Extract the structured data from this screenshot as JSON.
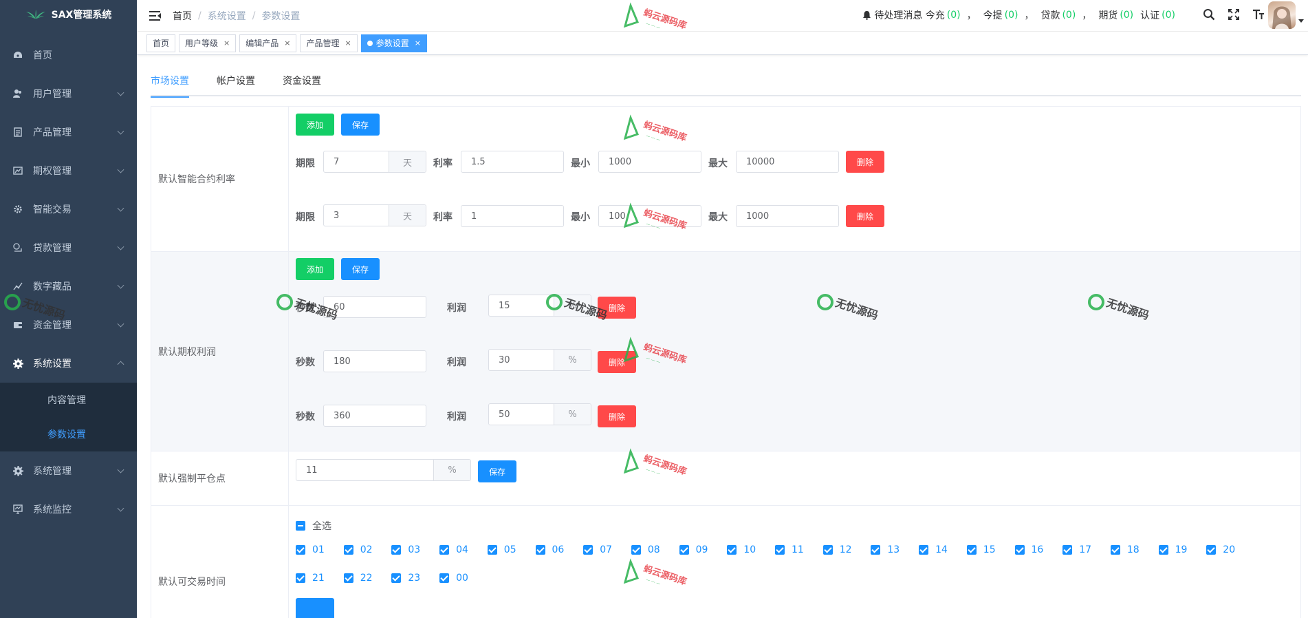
{
  "sidebar": {
    "logo_text": "SAX管理系统",
    "items": [
      {
        "label": "首页",
        "icon": "dashboard-icon"
      },
      {
        "label": "用户管理",
        "icon": "user-icon"
      },
      {
        "label": "产品管理",
        "icon": "document-icon"
      },
      {
        "label": "期权管理",
        "icon": "chart-icon"
      },
      {
        "label": "智能交易",
        "icon": "gear-icon"
      },
      {
        "label": "贷款管理",
        "icon": "money-icon"
      },
      {
        "label": "数字藏品",
        "icon": "trend-icon"
      },
      {
        "label": "资金管理",
        "icon": "wallet-icon"
      },
      {
        "label": "系统设置",
        "icon": "settings-icon"
      },
      {
        "label": "系统管理",
        "icon": "settings-icon"
      },
      {
        "label": "系统监控",
        "icon": "monitor-icon"
      }
    ],
    "sub_items": [
      {
        "label": "内容管理"
      },
      {
        "label": "参数设置"
      }
    ]
  },
  "header": {
    "breadcrumb": [
      "首页",
      "系统设置",
      "参数设置"
    ],
    "notify_label": "待处理消息 今充",
    "notify_items": [
      {
        "prefix": "",
        "count": "(0)",
        "sep": "，"
      },
      {
        "prefix": "今提",
        "count": "(0)",
        "sep": "，"
      },
      {
        "prefix": "贷款",
        "count": "(0)",
        "sep": "，"
      },
      {
        "prefix": "期货",
        "count": "(0)",
        "sep": ""
      },
      {
        "prefix": "认证",
        "count": "(0)",
        "sep": ""
      }
    ]
  },
  "tags": [
    {
      "label": "首页",
      "closable": false
    },
    {
      "label": "用户等级",
      "closable": true
    },
    {
      "label": "编辑产品",
      "closable": true
    },
    {
      "label": "产品管理",
      "closable": true
    },
    {
      "label": "参数设置",
      "closable": true,
      "active": true
    }
  ],
  "tabs": [
    "市场设置",
    "帐户设置",
    "资金设置"
  ],
  "rows": {
    "smart": {
      "label": "默认智能合约利率",
      "add": "添加",
      "save": "保存",
      "period_label": "期限",
      "unit": "天",
      "rate_label": "利率",
      "min_label": "最小",
      "max_label": "最大",
      "delete": "删除",
      "entries": [
        {
          "period": "7",
          "rate": "1.5",
          "min": "1000",
          "max": "10000"
        },
        {
          "period": "3",
          "rate": "1",
          "min": "100",
          "max": "1000"
        }
      ]
    },
    "option": {
      "label": "默认期权利润",
      "add": "添加",
      "save": "保存",
      "sec_label": "秒数",
      "profit_label": "利润",
      "unit": "%",
      "delete": "删除",
      "entries": [
        {
          "seconds": "60",
          "profit": "15"
        },
        {
          "seconds": "180",
          "profit": "30"
        },
        {
          "seconds": "360",
          "profit": "50"
        }
      ]
    },
    "liquidation": {
      "label": "默认强制平仓点",
      "value": "11",
      "unit": "%",
      "save": "保存"
    },
    "hours": {
      "label": "默认可交易时间",
      "select_all": "全选",
      "hours": [
        "01",
        "02",
        "03",
        "04",
        "05",
        "06",
        "07",
        "08",
        "09",
        "10",
        "11",
        "12",
        "13",
        "14",
        "15",
        "16",
        "17",
        "18",
        "19",
        "20",
        "21",
        "22",
        "23",
        "00"
      ]
    }
  },
  "watermark": {
    "a": "蚂云源码库",
    "b": "无忧源码"
  },
  "colors": {
    "sidebar": "#304156",
    "accent": "#1890ff",
    "green": "#13ce66",
    "red": "#ff4949"
  }
}
